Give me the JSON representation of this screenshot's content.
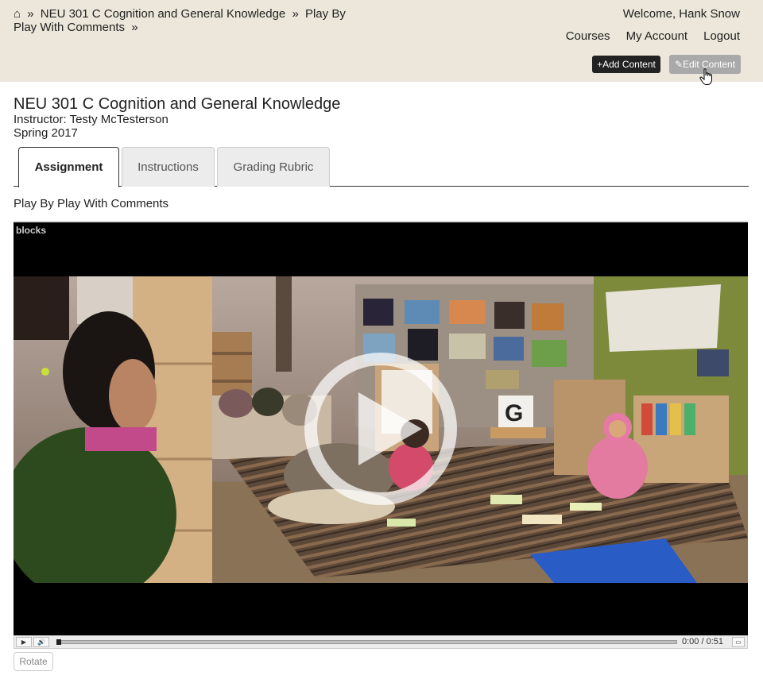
{
  "header": {
    "home_icon": "⌂",
    "breadcrumb": [
      {
        "label": "NEU 301 C Cognition and General Knowledge"
      },
      {
        "label": "Play By Play With Comments"
      }
    ],
    "separator": "»",
    "welcome": "Welcome, Hank Snow",
    "nav": [
      "Courses",
      "My Account",
      "Logout"
    ],
    "add_content_label": "+Add Content",
    "edit_content_label": "✎Edit Content"
  },
  "course": {
    "title": "NEU 301 C Cognition and General Knowledge",
    "instructor": "Instructor: Testy McTesterson",
    "term": "Spring 2017"
  },
  "tabs": [
    {
      "label": "Assignment",
      "active": true
    },
    {
      "label": "Instructions",
      "active": false
    },
    {
      "label": "Grading Rubric",
      "active": false
    }
  ],
  "assignment": {
    "title": "Play By Play With Comments"
  },
  "video": {
    "label": "blocks",
    "current_time": "0:00",
    "separator": "/",
    "duration": "0:51",
    "progress": 0
  },
  "rotate_label": "Rotate",
  "colors": {
    "header_bg": "#ece7da",
    "add_button_bg": "#222222",
    "edit_button_bg": "#a9a9a9"
  }
}
